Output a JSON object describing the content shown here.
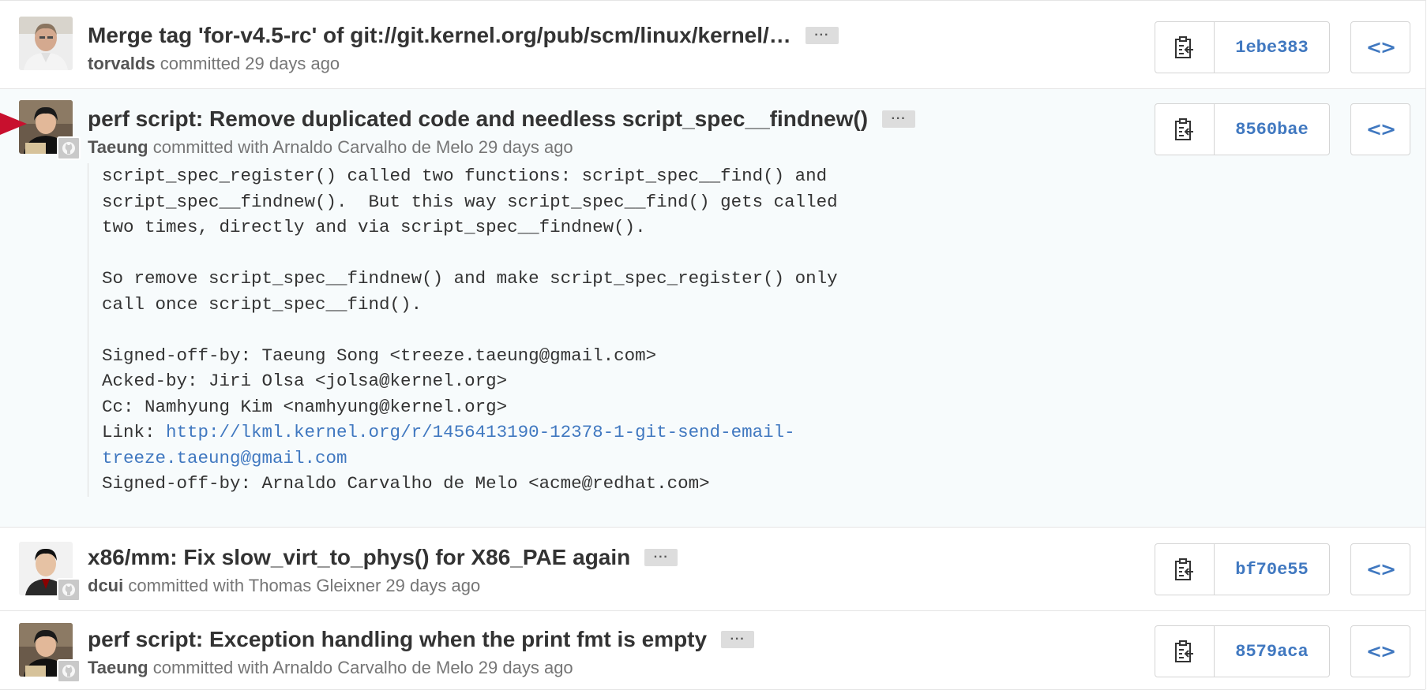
{
  "commits": [
    {
      "title": "Merge tag 'for-v4.5-rc' of git://git.kernel.org/pub/scm/linux/kernel/…",
      "ellipsis": "···",
      "author": "torvalds",
      "meta_rest": " committed 29 days ago",
      "sha": "1ebe383",
      "browse": "<>"
    },
    {
      "title": "perf script: Remove duplicated code and needless script_spec__findnew()",
      "ellipsis": "···",
      "author": "Taeung",
      "meta_rest": " committed with Arnaldo Carvalho de Melo 29 days ago",
      "sha": "8560bae",
      "browse": "<>",
      "description_before_link": "script_spec_register() called two functions: script_spec__find() and\nscript_spec__findnew().  But this way script_spec__find() gets called\ntwo times, directly and via script_spec__findnew().\n\nSo remove script_spec__findnew() and make script_spec_register() only\ncall once script_spec__find().\n\nSigned-off-by: Taeung Song <treeze.taeung@gmail.com>\nAcked-by: Jiri Olsa <jolsa@kernel.org>\nCc: Namhyung Kim <namhyung@kernel.org>\nLink: ",
      "description_link": "http://lkml.kernel.org/r/1456413190-12378-1-git-send-email-\ntreeze.taeung@gmail.com",
      "description_after_link": "\nSigned-off-by: Arnaldo Carvalho de Melo <acme@redhat.com>"
    },
    {
      "title": "x86/mm: Fix slow_virt_to_phys() for X86_PAE again",
      "ellipsis": "···",
      "author": "dcui",
      "meta_rest": " committed with Thomas Gleixner 29 days ago",
      "sha": "bf70e55",
      "browse": "<>"
    },
    {
      "title": "perf script: Exception handling when the print fmt is empty",
      "ellipsis": "···",
      "author": "Taeung",
      "meta_rest": " committed with Arnaldo Carvalho de Melo 29 days ago",
      "sha": "8579aca",
      "browse": "<>"
    }
  ],
  "icons": {
    "clipboard": "clipboard-icon",
    "browse": "code-icon",
    "github_small": "github-icon",
    "marker": "arrow-marker"
  },
  "colors": {
    "link_blue": "#4078c0",
    "expanded_bg": "#f7fbfc",
    "marker_red": "#c8102e"
  }
}
